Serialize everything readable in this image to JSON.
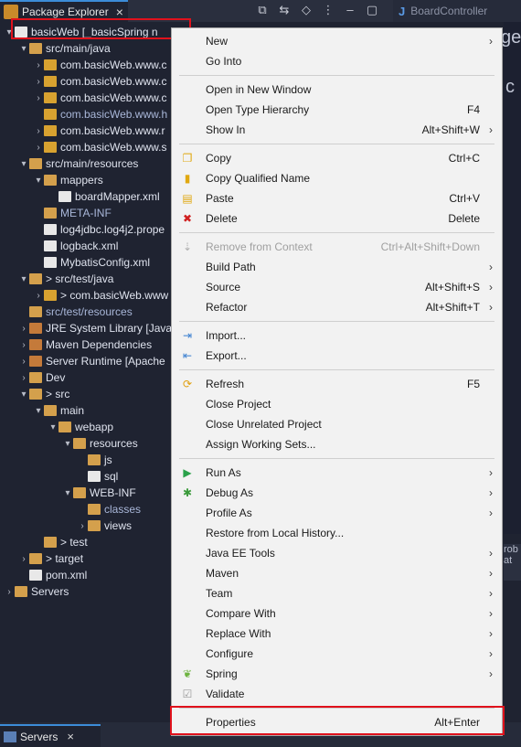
{
  "tabs": {
    "explorer_label": "Package Explorer",
    "editor_label": "BoardController",
    "editor_icon": "J"
  },
  "tree": [
    {
      "label": "basicWeb [_basicSpring n",
      "depth": 0,
      "arrow": "▾",
      "icon": "project"
    },
    {
      "label": "src/main/java",
      "depth": 1,
      "arrow": "▾",
      "icon": "folder"
    },
    {
      "label": "com.basicWeb.www.c",
      "depth": 2,
      "arrow": "›",
      "icon": "package"
    },
    {
      "label": "com.basicWeb.www.c",
      "depth": 2,
      "arrow": "›",
      "icon": "package"
    },
    {
      "label": "com.basicWeb.www.c",
      "depth": 2,
      "arrow": "›",
      "icon": "package"
    },
    {
      "label": "com.basicWeb.www.h",
      "depth": 2,
      "arrow": "",
      "icon": "package-empty"
    },
    {
      "label": "com.basicWeb.www.r",
      "depth": 2,
      "arrow": "›",
      "icon": "package"
    },
    {
      "label": "com.basicWeb.www.s",
      "depth": 2,
      "arrow": "›",
      "icon": "package"
    },
    {
      "label": "src/main/resources",
      "depth": 1,
      "arrow": "▾",
      "icon": "folder"
    },
    {
      "label": "mappers",
      "depth": 2,
      "arrow": "▾",
      "icon": "folder"
    },
    {
      "label": "boardMapper.xml",
      "depth": 3,
      "arrow": "",
      "icon": "file"
    },
    {
      "label": "META-INF",
      "depth": 2,
      "arrow": "",
      "icon": "folder"
    },
    {
      "label": "log4jdbc.log4j2.prope",
      "depth": 2,
      "arrow": "",
      "icon": "file"
    },
    {
      "label": "logback.xml",
      "depth": 2,
      "arrow": "",
      "icon": "file"
    },
    {
      "label": "MybatisConfig.xml",
      "depth": 2,
      "arrow": "",
      "icon": "file"
    },
    {
      "label": "> src/test/java",
      "depth": 1,
      "arrow": "▾",
      "icon": "folder"
    },
    {
      "label": "> com.basicWeb.www",
      "depth": 2,
      "arrow": "›",
      "icon": "package"
    },
    {
      "label": "src/test/resources",
      "depth": 1,
      "arrow": "",
      "icon": "folder"
    },
    {
      "label": "JRE System Library [JavaS",
      "depth": 1,
      "arrow": "›",
      "icon": "jar"
    },
    {
      "label": "Maven Dependencies",
      "depth": 1,
      "arrow": "›",
      "icon": "jar"
    },
    {
      "label": "Server Runtime [Apache",
      "depth": 1,
      "arrow": "›",
      "icon": "jar"
    },
    {
      "label": "Dev",
      "depth": 1,
      "arrow": "›",
      "icon": "folder"
    },
    {
      "label": "> src",
      "depth": 1,
      "arrow": "▾",
      "icon": "folder"
    },
    {
      "label": "main",
      "depth": 2,
      "arrow": "▾",
      "icon": "folder"
    },
    {
      "label": "webapp",
      "depth": 3,
      "arrow": "▾",
      "icon": "folder"
    },
    {
      "label": "resources",
      "depth": 4,
      "arrow": "▾",
      "icon": "folder"
    },
    {
      "label": "js",
      "depth": 5,
      "arrow": "",
      "icon": "folder"
    },
    {
      "label": "sql",
      "depth": 5,
      "arrow": "",
      "icon": "file"
    },
    {
      "label": "WEB-INF",
      "depth": 4,
      "arrow": "▾",
      "icon": "folder"
    },
    {
      "label": "classes",
      "depth": 5,
      "arrow": "",
      "icon": "folder"
    },
    {
      "label": "views",
      "depth": 5,
      "arrow": "›",
      "icon": "folder"
    },
    {
      "label": "> test",
      "depth": 2,
      "arrow": "",
      "icon": "folder"
    },
    {
      "label": "> target",
      "depth": 1,
      "arrow": "›",
      "icon": "folder"
    },
    {
      "label": "pom.xml",
      "depth": 1,
      "arrow": "",
      "icon": "file"
    },
    {
      "label": "Servers",
      "depth": 0,
      "arrow": "›",
      "icon": "folder"
    }
  ],
  "right_fragments": {
    "a": "ge",
    "b": "c",
    "c": "rob",
    "d": "at"
  },
  "bottom": {
    "servers_label": "Servers"
  },
  "menu": [
    {
      "label": "New",
      "shortcut": "",
      "submenu": true,
      "icon": ""
    },
    {
      "label": "Go Into",
      "shortcut": "",
      "submenu": false,
      "icon": ""
    },
    {
      "sep": true
    },
    {
      "label": "Open in New Window",
      "shortcut": "",
      "submenu": false,
      "icon": ""
    },
    {
      "label": "Open Type Hierarchy",
      "shortcut": "F4",
      "submenu": false,
      "icon": ""
    },
    {
      "label": "Show In",
      "shortcut": "Alt+Shift+W",
      "submenu": true,
      "icon": ""
    },
    {
      "sep": true
    },
    {
      "label": "Copy",
      "shortcut": "Ctrl+C",
      "submenu": false,
      "icon": "copy-icon"
    },
    {
      "label": "Copy Qualified Name",
      "shortcut": "",
      "submenu": false,
      "icon": "copy-qualified-icon"
    },
    {
      "label": "Paste",
      "shortcut": "Ctrl+V",
      "submenu": false,
      "icon": "paste-icon"
    },
    {
      "label": "Delete",
      "shortcut": "Delete",
      "submenu": false,
      "icon": "delete-icon"
    },
    {
      "sep": true
    },
    {
      "label": "Remove from Context",
      "shortcut": "Ctrl+Alt+Shift+Down",
      "submenu": false,
      "icon": "remove-context-icon",
      "disabled": true
    },
    {
      "label": "Build Path",
      "shortcut": "",
      "submenu": true,
      "icon": ""
    },
    {
      "label": "Source",
      "shortcut": "Alt+Shift+S",
      "submenu": true,
      "icon": ""
    },
    {
      "label": "Refactor",
      "shortcut": "Alt+Shift+T",
      "submenu": true,
      "icon": ""
    },
    {
      "sep": true
    },
    {
      "label": "Import...",
      "shortcut": "",
      "submenu": false,
      "icon": "import-icon"
    },
    {
      "label": "Export...",
      "shortcut": "",
      "submenu": false,
      "icon": "export-icon"
    },
    {
      "sep": true
    },
    {
      "label": "Refresh",
      "shortcut": "F5",
      "submenu": false,
      "icon": "refresh-icon"
    },
    {
      "label": "Close Project",
      "shortcut": "",
      "submenu": false,
      "icon": ""
    },
    {
      "label": "Close Unrelated Project",
      "shortcut": "",
      "submenu": false,
      "icon": ""
    },
    {
      "label": "Assign Working Sets...",
      "shortcut": "",
      "submenu": false,
      "icon": ""
    },
    {
      "sep": true
    },
    {
      "label": "Run As",
      "shortcut": "",
      "submenu": true,
      "icon": "run-icon"
    },
    {
      "label": "Debug As",
      "shortcut": "",
      "submenu": true,
      "icon": "debug-icon"
    },
    {
      "label": "Profile As",
      "shortcut": "",
      "submenu": true,
      "icon": ""
    },
    {
      "label": "Restore from Local History...",
      "shortcut": "",
      "submenu": false,
      "icon": ""
    },
    {
      "label": "Java EE Tools",
      "shortcut": "",
      "submenu": true,
      "icon": ""
    },
    {
      "label": "Maven",
      "shortcut": "",
      "submenu": true,
      "icon": ""
    },
    {
      "label": "Team",
      "shortcut": "",
      "submenu": true,
      "icon": ""
    },
    {
      "label": "Compare With",
      "shortcut": "",
      "submenu": true,
      "icon": ""
    },
    {
      "label": "Replace With",
      "shortcut": "",
      "submenu": true,
      "icon": ""
    },
    {
      "label": "Configure",
      "shortcut": "",
      "submenu": true,
      "icon": ""
    },
    {
      "label": "Spring",
      "shortcut": "",
      "submenu": true,
      "icon": "spring-icon"
    },
    {
      "label": "Validate",
      "shortcut": "",
      "submenu": false,
      "icon": "validate-icon"
    },
    {
      "sep": true
    },
    {
      "label": "Properties",
      "shortcut": "Alt+Enter",
      "submenu": false,
      "icon": ""
    }
  ],
  "colors": {
    "highlight": "#e0121c",
    "menu_bg": "#f2f2f2",
    "ide_bg": "#1f2331"
  }
}
